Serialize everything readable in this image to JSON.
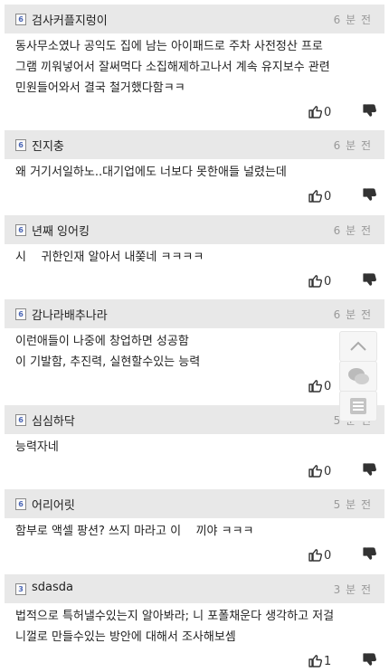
{
  "comments": [
    {
      "nick": "검사커플지렁이",
      "grade_icon": "level-6-icon",
      "time": "6 분 전",
      "lines": [
        "동사무소였나 공익도 집에 남는 아이패드로 주차 사전정산 프로",
        "그램 끼워넣어서 잘써먹다 소집해제하고나서 계속 유지보수 관련",
        "민원들어와서 결국 철거했다함ㅋㅋ"
      ],
      "votes": "0"
    },
    {
      "nick": "진지충",
      "grade_icon": "level-6-icon",
      "time": "6 분 전",
      "lines": [
        "왜 거기서일하노..대기업에도 너보다 못한애들 널렸는데"
      ],
      "votes": "0"
    },
    {
      "nick": "년째 잉어킹",
      "grade_icon": "level-6-icon",
      "time": "6 분 전",
      "lines": [
        "시    귀한인재 알아서 내쫒네 ㅋㅋㅋㅋ"
      ],
      "votes": "0"
    },
    {
      "nick": "감나라배추나라",
      "grade_icon": "level-6-icon",
      "time": "6 분 전",
      "lines": [
        "이런애들이 나중에 창업하면 성공함",
        "이 기발함, 추진력, 실현할수있는 능력"
      ],
      "votes": "0"
    },
    {
      "nick": "심심하닥",
      "grade_icon": "level-6-icon",
      "time": "5 분 전",
      "lines": [
        "능력자네"
      ],
      "votes": "0"
    },
    {
      "nick": "어리어릿",
      "grade_icon": "level-6-icon",
      "time": "5 분 전",
      "lines": [
        "함부로 액셀 팡션? 쓰지 마라고 이    끼야 ㅋㅋㅋ"
      ],
      "votes": "0"
    },
    {
      "nick": "sdasda",
      "grade_icon": "level-3-icon",
      "time": "3 분 전",
      "lines": [
        "법적으로 특허낼수있는지 알아봐라; 니 포폴채운다 생각하고 저걸",
        "니껄로 만들수있는 방안에 대해서 조사해보셈"
      ],
      "votes": "1"
    }
  ],
  "grade_labels": {
    "level-6-icon": "6",
    "level-3-icon": "3"
  },
  "floating": [
    "scroll-top-icon",
    "comments-icon",
    "list-icon"
  ],
  "colors": {
    "header_bg": "#e8e8e8",
    "time": "#999999",
    "grade_icon": "#4a66b6"
  }
}
